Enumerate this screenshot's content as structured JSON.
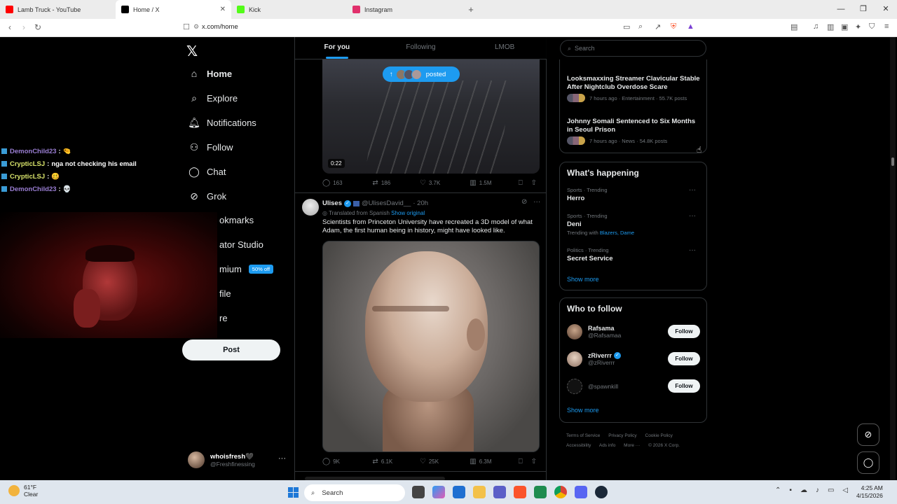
{
  "browser": {
    "tabs": [
      {
        "label": "Lamb Truck - YouTube",
        "favicon_color": "#ff0000"
      },
      {
        "label": "Home / X",
        "favicon_color": "#000000"
      },
      {
        "label": "Kick",
        "favicon_color": "#53fc18"
      },
      {
        "label": "Instagram",
        "favicon_color": "#e1306c"
      }
    ],
    "url": "x.com/home"
  },
  "nav": {
    "items": [
      {
        "label": "Home",
        "icon": "home-icon"
      },
      {
        "label": "Explore",
        "icon": "search-icon"
      },
      {
        "label": "Notifications",
        "icon": "bell-icon"
      },
      {
        "label": "Follow",
        "icon": "person-add-icon"
      },
      {
        "label": "Chat",
        "icon": "chat-icon"
      },
      {
        "label": "Grok",
        "icon": "grok-icon"
      },
      {
        "label": "okmarks"
      },
      {
        "label": "ator Studio"
      },
      {
        "label": "mium",
        "badge": "50% off"
      },
      {
        "label": "file"
      },
      {
        "label": "re"
      }
    ],
    "post_label": "Post",
    "user": {
      "name": "whoisfresh🖤",
      "handle": "@Freshfinessing"
    }
  },
  "stream_chat": [
    {
      "user": "DemonChild23",
      "message": "🤏",
      "color": "#9b7fd4"
    },
    {
      "user": "CrypticLSJ",
      "message": "nga not checking his email",
      "color": "#d8e36b"
    },
    {
      "user": "CrypticLSJ",
      "message": "🥴",
      "color": "#d8e36b"
    },
    {
      "user": "DemonChild23",
      "message": "💀",
      "color": "#9b7fd4"
    }
  ],
  "feed": {
    "tabs": [
      "For you",
      "Following",
      "LMOB"
    ],
    "posted_pill": "posted",
    "tweet1": {
      "duration": "0:22",
      "replies": "163",
      "reposts": "186",
      "likes": "3.7K",
      "views": "1.5M"
    },
    "tweet2": {
      "name": "Ulises",
      "handle": "@UlisesDavid__",
      "time": "· 20h",
      "translated": "Translated from Spanish",
      "show_original": "Show original",
      "text": "Scientists from Princeton University have recreated a 3D model of what Adam, the first human being in history, might have looked like.",
      "replies": "9K",
      "reposts": "6.1K",
      "likes": "25K",
      "views": "6.3M"
    }
  },
  "sidebar": {
    "search_placeholder": "Search",
    "news": [
      {
        "headline": "Looksmaxxing Streamer Clavicular Stable After Nightclub Overdose Scare",
        "meta": "7 hours ago · Entertainment · 55.7K posts"
      },
      {
        "headline": "Johnny Somali Sentenced to Six Months in Seoul Prison",
        "meta": "7 hours ago · News · 54.8K posts"
      }
    ],
    "happening_title": "What's happening",
    "trends": [
      {
        "context": "Sports · Trending",
        "name": "Herro"
      },
      {
        "context": "Sports · Trending",
        "name": "Deni",
        "with_label": "Trending with",
        "with": "Blazers, Dame"
      },
      {
        "context": "Politics · Trending",
        "name": "Secret Service"
      }
    ],
    "show_more": "Show more",
    "wtf_title": "Who to follow",
    "wtf": [
      {
        "name": "Rafsama",
        "handle": "@Rafsamaa",
        "verified": false
      },
      {
        "name": "zRiverrr",
        "handle": "@zRiverrr",
        "verified": true
      },
      {
        "name": "",
        "handle": "@spawnkill",
        "verified": false
      }
    ],
    "follow_label": "Follow",
    "footer": [
      "Terms of Service",
      "Privacy Policy",
      "Cookie Policy",
      "Accessibility",
      "Ads info",
      "More ···",
      "© 2026 X Corp."
    ]
  },
  "taskbar": {
    "temp": "61°F",
    "condition": "Clear",
    "search": "Search",
    "time": "4:25 AM",
    "date": "4/15/2026"
  }
}
